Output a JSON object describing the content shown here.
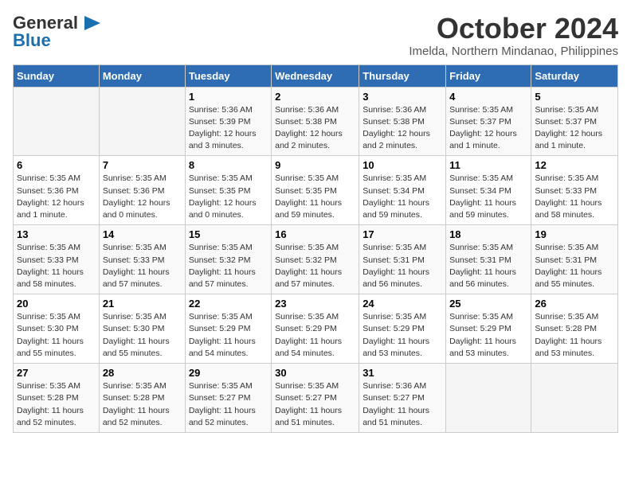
{
  "logo": {
    "text_general": "General",
    "text_blue": "Blue",
    "icon": "▶"
  },
  "title": "October 2024",
  "location": "Imelda, Northern Mindanao, Philippines",
  "days_of_week": [
    "Sunday",
    "Monday",
    "Tuesday",
    "Wednesday",
    "Thursday",
    "Friday",
    "Saturday"
  ],
  "weeks": [
    [
      {
        "day": "",
        "info": ""
      },
      {
        "day": "",
        "info": ""
      },
      {
        "day": "1",
        "info": "Sunrise: 5:36 AM\nSunset: 5:39 PM\nDaylight: 12 hours and 3 minutes."
      },
      {
        "day": "2",
        "info": "Sunrise: 5:36 AM\nSunset: 5:38 PM\nDaylight: 12 hours and 2 minutes."
      },
      {
        "day": "3",
        "info": "Sunrise: 5:36 AM\nSunset: 5:38 PM\nDaylight: 12 hours and 2 minutes."
      },
      {
        "day": "4",
        "info": "Sunrise: 5:35 AM\nSunset: 5:37 PM\nDaylight: 12 hours and 1 minute."
      },
      {
        "day": "5",
        "info": "Sunrise: 5:35 AM\nSunset: 5:37 PM\nDaylight: 12 hours and 1 minute."
      }
    ],
    [
      {
        "day": "6",
        "info": "Sunrise: 5:35 AM\nSunset: 5:36 PM\nDaylight: 12 hours and 1 minute."
      },
      {
        "day": "7",
        "info": "Sunrise: 5:35 AM\nSunset: 5:36 PM\nDaylight: 12 hours and 0 minutes."
      },
      {
        "day": "8",
        "info": "Sunrise: 5:35 AM\nSunset: 5:35 PM\nDaylight: 12 hours and 0 minutes."
      },
      {
        "day": "9",
        "info": "Sunrise: 5:35 AM\nSunset: 5:35 PM\nDaylight: 11 hours and 59 minutes."
      },
      {
        "day": "10",
        "info": "Sunrise: 5:35 AM\nSunset: 5:34 PM\nDaylight: 11 hours and 59 minutes."
      },
      {
        "day": "11",
        "info": "Sunrise: 5:35 AM\nSunset: 5:34 PM\nDaylight: 11 hours and 59 minutes."
      },
      {
        "day": "12",
        "info": "Sunrise: 5:35 AM\nSunset: 5:33 PM\nDaylight: 11 hours and 58 minutes."
      }
    ],
    [
      {
        "day": "13",
        "info": "Sunrise: 5:35 AM\nSunset: 5:33 PM\nDaylight: 11 hours and 58 minutes."
      },
      {
        "day": "14",
        "info": "Sunrise: 5:35 AM\nSunset: 5:33 PM\nDaylight: 11 hours and 57 minutes."
      },
      {
        "day": "15",
        "info": "Sunrise: 5:35 AM\nSunset: 5:32 PM\nDaylight: 11 hours and 57 minutes."
      },
      {
        "day": "16",
        "info": "Sunrise: 5:35 AM\nSunset: 5:32 PM\nDaylight: 11 hours and 57 minutes."
      },
      {
        "day": "17",
        "info": "Sunrise: 5:35 AM\nSunset: 5:31 PM\nDaylight: 11 hours and 56 minutes."
      },
      {
        "day": "18",
        "info": "Sunrise: 5:35 AM\nSunset: 5:31 PM\nDaylight: 11 hours and 56 minutes."
      },
      {
        "day": "19",
        "info": "Sunrise: 5:35 AM\nSunset: 5:31 PM\nDaylight: 11 hours and 55 minutes."
      }
    ],
    [
      {
        "day": "20",
        "info": "Sunrise: 5:35 AM\nSunset: 5:30 PM\nDaylight: 11 hours and 55 minutes."
      },
      {
        "day": "21",
        "info": "Sunrise: 5:35 AM\nSunset: 5:30 PM\nDaylight: 11 hours and 55 minutes."
      },
      {
        "day": "22",
        "info": "Sunrise: 5:35 AM\nSunset: 5:29 PM\nDaylight: 11 hours and 54 minutes."
      },
      {
        "day": "23",
        "info": "Sunrise: 5:35 AM\nSunset: 5:29 PM\nDaylight: 11 hours and 54 minutes."
      },
      {
        "day": "24",
        "info": "Sunrise: 5:35 AM\nSunset: 5:29 PM\nDaylight: 11 hours and 53 minutes."
      },
      {
        "day": "25",
        "info": "Sunrise: 5:35 AM\nSunset: 5:29 PM\nDaylight: 11 hours and 53 minutes."
      },
      {
        "day": "26",
        "info": "Sunrise: 5:35 AM\nSunset: 5:28 PM\nDaylight: 11 hours and 53 minutes."
      }
    ],
    [
      {
        "day": "27",
        "info": "Sunrise: 5:35 AM\nSunset: 5:28 PM\nDaylight: 11 hours and 52 minutes."
      },
      {
        "day": "28",
        "info": "Sunrise: 5:35 AM\nSunset: 5:28 PM\nDaylight: 11 hours and 52 minutes."
      },
      {
        "day": "29",
        "info": "Sunrise: 5:35 AM\nSunset: 5:27 PM\nDaylight: 11 hours and 52 minutes."
      },
      {
        "day": "30",
        "info": "Sunrise: 5:35 AM\nSunset: 5:27 PM\nDaylight: 11 hours and 51 minutes."
      },
      {
        "day": "31",
        "info": "Sunrise: 5:36 AM\nSunset: 5:27 PM\nDaylight: 11 hours and 51 minutes."
      },
      {
        "day": "",
        "info": ""
      },
      {
        "day": "",
        "info": ""
      }
    ]
  ]
}
